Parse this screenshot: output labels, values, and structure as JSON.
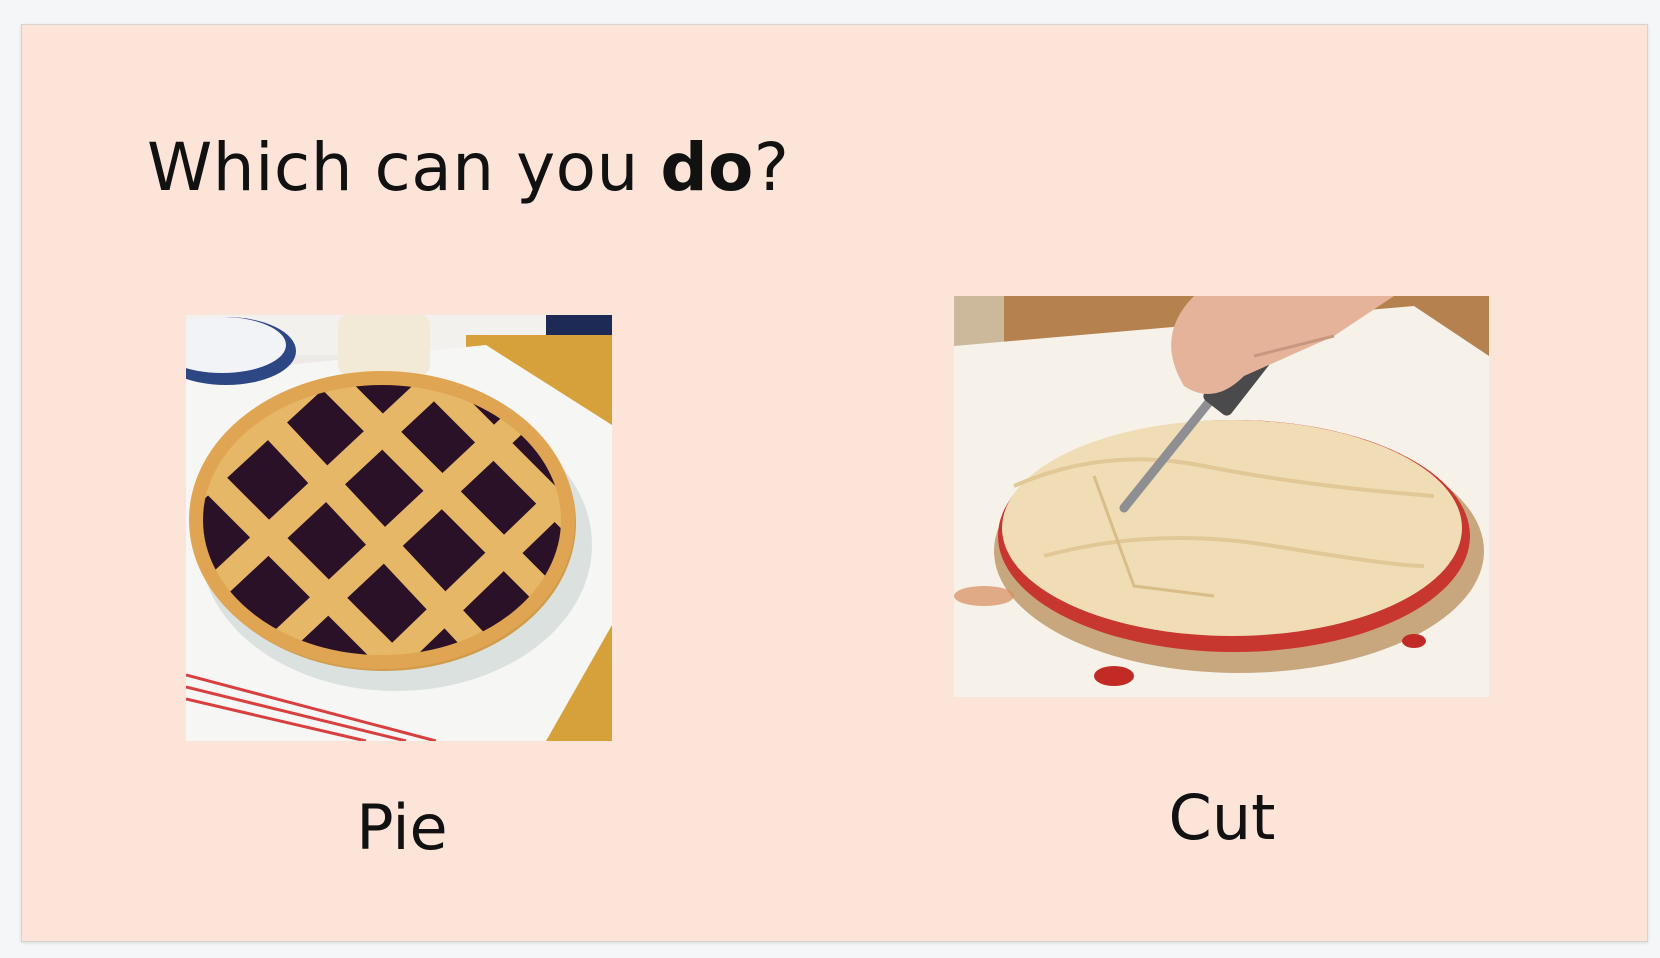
{
  "slide": {
    "title_pre": "Which can you ",
    "title_bold": "do",
    "title_post": "?",
    "background_color": "#fce4d8"
  },
  "cards": [
    {
      "caption": "Pie",
      "image_subject": "blueberry lattice pie"
    },
    {
      "caption": "Cut",
      "image_subject": "hand cutting a pie with a knife"
    }
  ]
}
